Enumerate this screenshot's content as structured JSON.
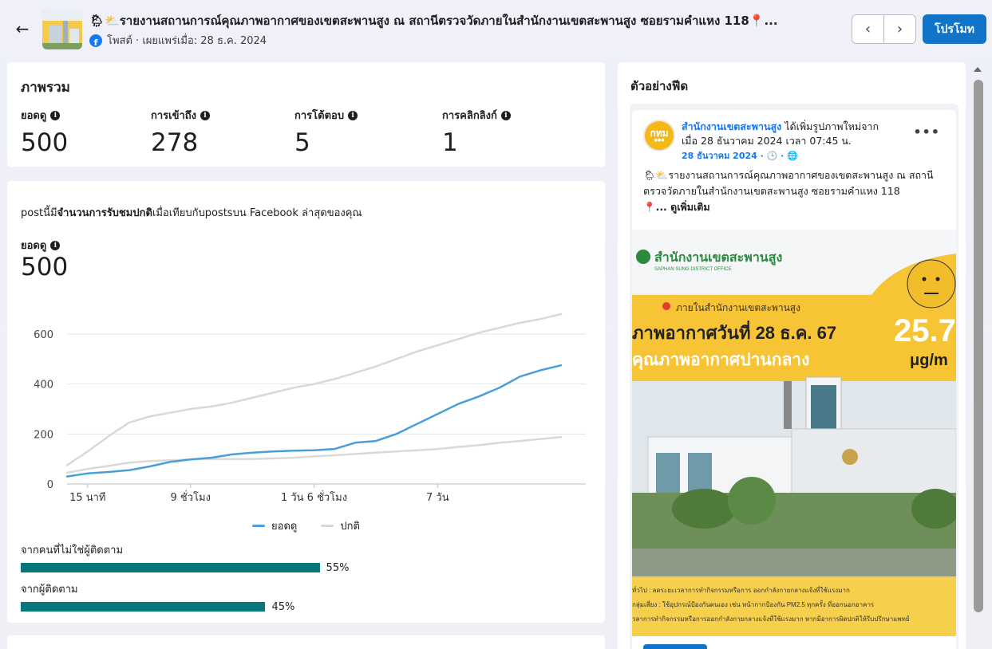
{
  "header": {
    "back_icon": "arrow-left-icon",
    "title": "🌦⛅รายงานสถานการณ์คุณภาพอากาศของเขตสะพานสูง ณ สถานีตรวจวัดภายในสำนักงานเขตสะพานสูง ซอยรามคำแหง 118📍...",
    "platform_icon": "facebook-icon",
    "subtitle": "โพสต์ · เผยแพร่เมื่อ: 28 ธ.ค. 2024",
    "prev_icon": "chevron-left-icon",
    "next_icon": "chevron-right-icon",
    "promote_label": "โปรโมท"
  },
  "overview": {
    "title": "ภาพรวม",
    "metrics": [
      {
        "label": "ยอดดู",
        "value": "500"
      },
      {
        "label": "การเข้าถึง",
        "value": "278"
      },
      {
        "label": "การโต้ตอบ",
        "value": "5"
      },
      {
        "label": "การคลิกลิงก์",
        "value": "1"
      }
    ]
  },
  "chart_section": {
    "note_prefix": "postนี้มี",
    "note_bold": "จำนวนการรับชมปกติ",
    "note_suffix": "เมื่อเทียบกับpostsบน Facebook ล่าสุดของคุณ",
    "views_label": "ยอดดู",
    "views_value": "500",
    "legend": [
      {
        "label": "ยอดดู",
        "color": "#4a9fd8"
      },
      {
        "label": "ปกติ",
        "color": "#d9d9d9"
      }
    ],
    "audience": [
      {
        "label": "จากคนที่ไม่ใช่ผู้ติดตาม",
        "percent_text": "55%",
        "fraction": 0.55
      },
      {
        "label": "จากผู้ติดตาม",
        "percent_text": "45%",
        "fraction": 0.45
      }
    ]
  },
  "chart_data": {
    "type": "line",
    "x_tick_labels": [
      "15 นาที",
      "9 ชั่วโมง",
      "1 วัน 6 ชั่วโมง",
      "7 วัน"
    ],
    "x_tick_positions": [
      0.5,
      3,
      6,
      9
    ],
    "xlim": [
      0,
      12.6
    ],
    "ylim": [
      0,
      600
    ],
    "y_ticks": [
      0,
      200,
      400,
      600
    ],
    "grid": true,
    "legend_position": "bottom",
    "series": [
      {
        "name": "ยอดดู",
        "color": "#4a9fd8",
        "x": [
          0,
          0.5,
          1,
          1.5,
          2,
          2.5,
          3,
          3.5,
          4,
          4.5,
          5,
          5.5,
          6,
          6.5,
          7,
          7.5,
          8,
          8.5,
          9,
          9.5,
          10,
          10.5,
          11,
          11.5,
          12
        ],
        "y": [
          30,
          42,
          48,
          55,
          70,
          88,
          98,
          105,
          118,
          125,
          130,
          133,
          135,
          140,
          165,
          172,
          200,
          240,
          280,
          320,
          350,
          385,
          430,
          455,
          475
        ]
      },
      {
        "name": "ปกติ upper",
        "color": "#d9d9d9",
        "x": [
          0,
          0.5,
          1,
          1.5,
          2,
          2.5,
          3,
          3.5,
          4,
          4.5,
          5,
          5.5,
          6,
          6.5,
          7,
          7.5,
          8,
          8.5,
          9,
          9.5,
          10,
          10.5,
          11,
          11.5,
          12
        ],
        "y": [
          75,
          130,
          190,
          245,
          270,
          285,
          300,
          310,
          325,
          345,
          365,
          385,
          400,
          420,
          445,
          470,
          500,
          530,
          555,
          580,
          605,
          625,
          645,
          660,
          680
        ]
      },
      {
        "name": "ปกติ lower",
        "color": "#d9d9d9",
        "x": [
          0,
          0.5,
          1,
          1.5,
          2,
          2.5,
          3,
          3.5,
          4,
          4.5,
          5,
          5.5,
          6,
          6.5,
          7,
          7.5,
          8,
          8.5,
          9,
          9.5,
          10,
          10.5,
          11,
          11.5,
          12
        ],
        "y": [
          45,
          60,
          72,
          85,
          92,
          95,
          98,
          100,
          100,
          100,
          102,
          105,
          110,
          115,
          120,
          125,
          130,
          135,
          140,
          148,
          155,
          165,
          172,
          180,
          188
        ]
      }
    ]
  },
  "preview": {
    "title": "ตัวอย่างฟีด",
    "page_name": "สำนักงานเขตสะพานสูง",
    "avatar_text": "กทม",
    "head_text": " ได้เพิ่มรูปภาพใหม่จาก",
    "head_line2": "เมื่อ 28 ธันวาคม 2024 เวลา 07:45 น.",
    "date_meta": "28 ธันวาคม 2024 · 🕒 · 🌐",
    "more_icon": "more-horizontal-icon",
    "body_text": "🌦⛅รายงานสถานการณ์คุณภาพอากาศของเขตสะพานสูง ณ สถานีตรวจวัดภายในสำนักงานเขตสะพานสูง ซอยรามคำแหง 118",
    "see_more": "📍... ดูเพิ่มเติม",
    "image": {
      "office_name": "สำนักงานเขตสะพานสูง",
      "office_name_en": "SAPHAN SUNG DISTRICT OFFICE",
      "location": "ภายในสำนักงานเขตสะพานสูง",
      "headline": "ภาพอากาศวันที่ 28 ธ.ค. 67",
      "subheadline": "คุณภาพอากาศปานกลาง",
      "pm_value": "25.7",
      "pm_unit": "μg/m",
      "notes": [
        "ทั่วไป : ลดระยะเวลาการทำกิจกรรมหรือการ ออกกำลังกายกลางแจ้งที่ใช้แรงมาก",
        "กลุ่มเสี่ยง : ใช้อุปกรณ์ป้องกันตนเอง เช่น หน้ากากป้องกัน PM2.5 ทุกครั้ง ที่ออกนอกอาคาร",
        "วลาการทำกิจกรรมหรือการออกกำลังกายกลางแจ้งที่ใช้แรงมาก หากมีอาการผิดปกติให้รีบปรึกษาแพทย์"
      ]
    }
  }
}
